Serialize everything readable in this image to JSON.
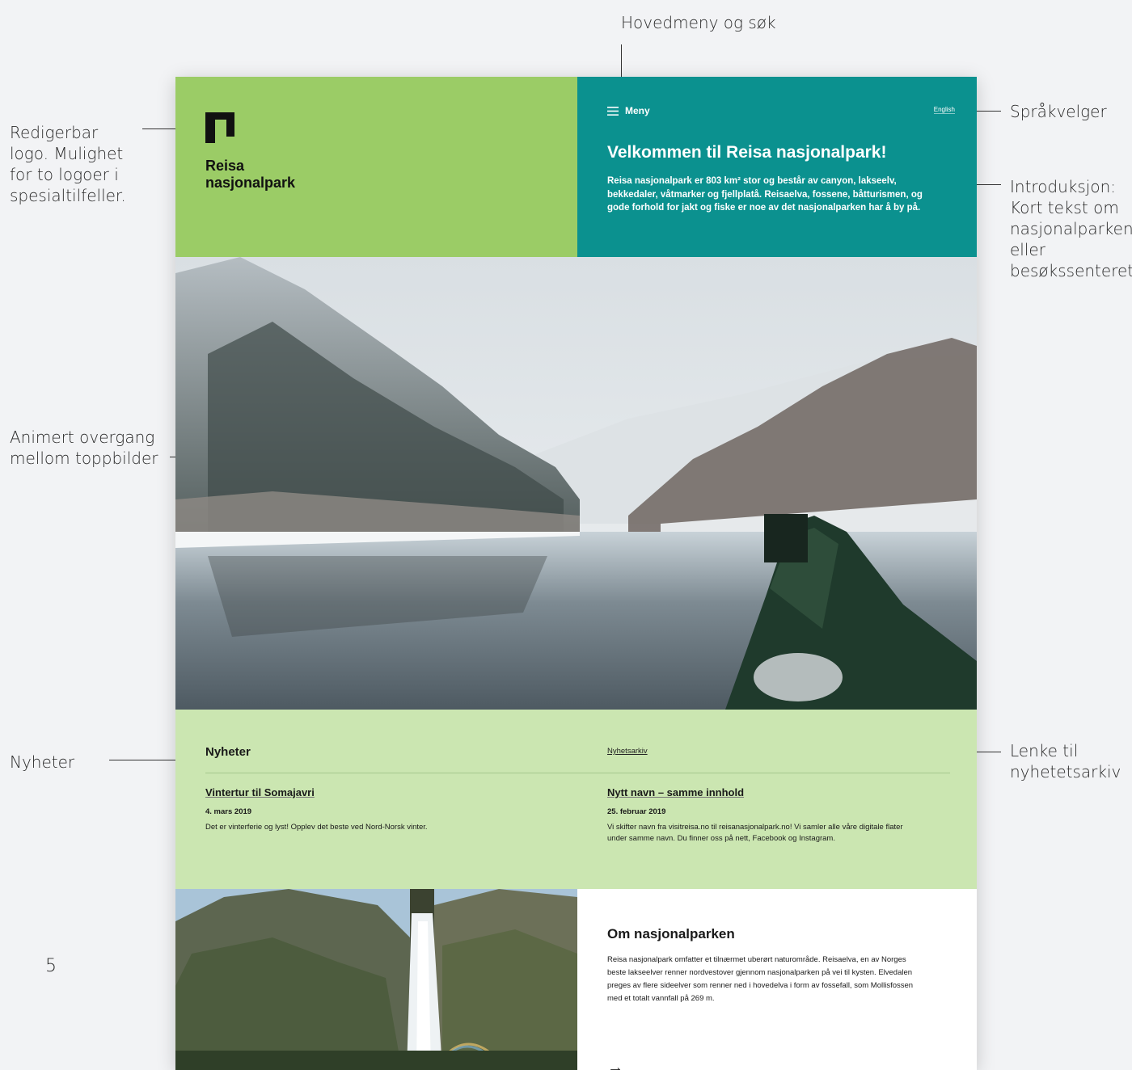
{
  "annotations": {
    "menu_search": "Hovedmeny og søk",
    "logo": "Redigerbar logo. Mulighet for to logoer i spesialtilfeller.",
    "language": "Språkvelger",
    "intro": "Introduksjon: Kort tekst om nasjonalparken eller besøkssenteret",
    "transition": "Animert overgang mellom toppbilder",
    "news": "Nyheter",
    "archive_link": "Lenke til nyhetetsarkiv",
    "page_number": "5"
  },
  "header": {
    "logo_text": "Reisa\nnasjonalpark",
    "menu_label": "Meny",
    "language_label": "English",
    "intro_title": "Velkommen til Reisa nasjonalpark!",
    "intro_text": "Reisa nasjonalpark er 803 km² stor og består av canyon, lakseelv, bekkedaler, våtmarker og fjellplatå. Reisaelva, fossene, båtturismen, og gode forhold for jakt og fiske er noe av det nasjonalparken har å by på."
  },
  "news": {
    "heading": "Nyheter",
    "archive_label": "Nyhetsarkiv",
    "items": [
      {
        "title": "Vintertur til Somajavri",
        "date": "4. mars 2019",
        "text": "Det er vinterferie og lyst! Opplev det beste ved Nord-Norsk vinter."
      },
      {
        "title": "Nytt navn – samme innhold",
        "date": "25. februar 2019",
        "text": "Vi skifter navn fra visitreisa.no til reisanasjonalpark.no! Vi samler alle våre digitale flater under samme navn. Du finner oss på nett, Facebook og Instagram."
      }
    ]
  },
  "about": {
    "title": "Om nasjonalparken",
    "text": "Reisa nasjonalpark omfatter et tilnærmet uberørt naturområde. Reisaelva, en av Norges beste lakseelver renner nordvestover gjennom nasjonalparken på vei til kysten. Elvedalen preges av flere sideelver som renner ned i hovedelva i form av fossefall, som Mollisfossen med et totalt vannfall på 269 m.",
    "arrow": "→"
  },
  "colors": {
    "logo_green": "#9bcc66",
    "intro_teal": "#0b918f",
    "news_green": "#cbe6b1"
  }
}
